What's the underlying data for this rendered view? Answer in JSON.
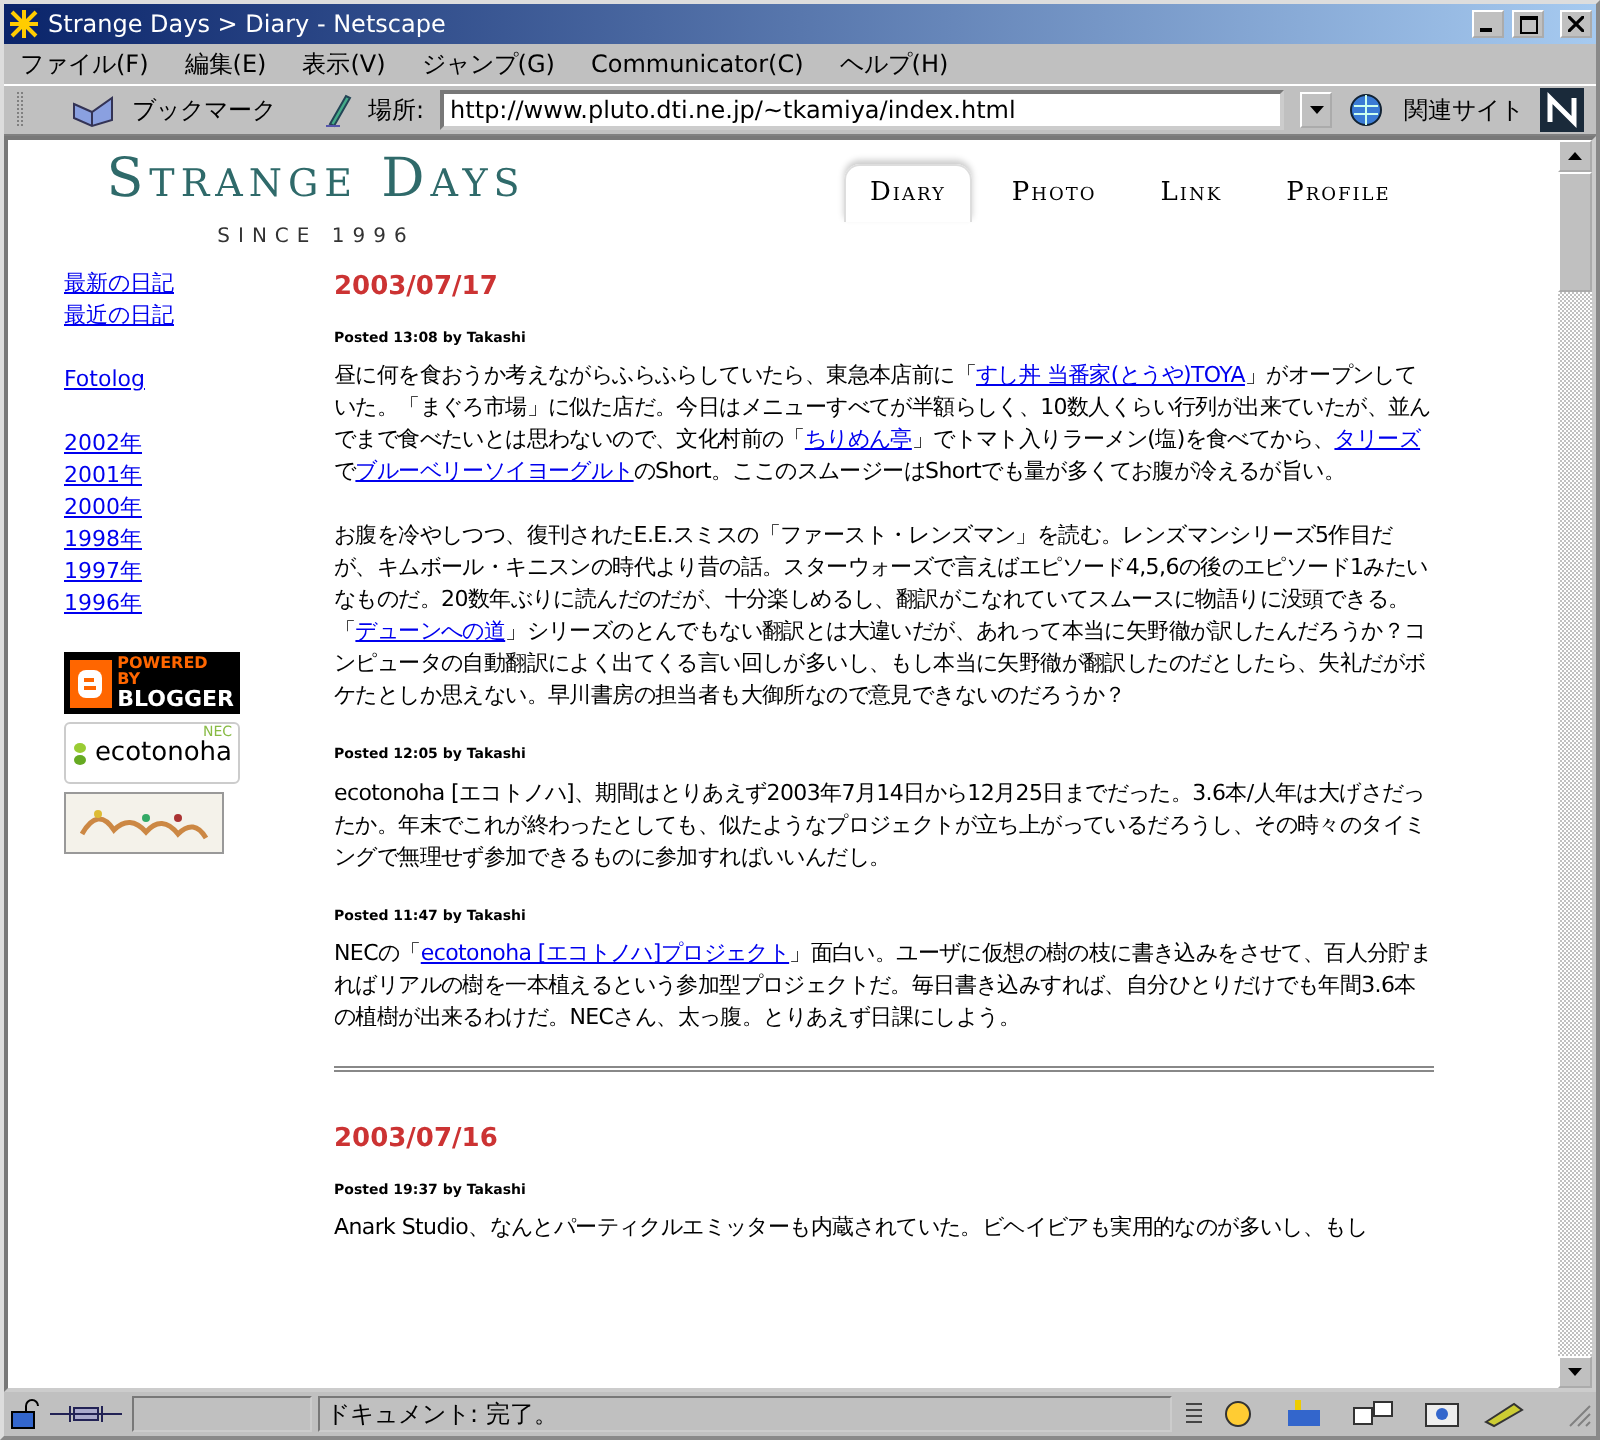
{
  "window": {
    "title": "Strange Days > Diary - Netscape"
  },
  "menu": [
    "ファイル(F)",
    "編集(E)",
    "表示(V)",
    "ジャンプ(G)",
    "Communicator(C)",
    "ヘルプ(H)"
  ],
  "toolbar": {
    "bookmarks": "ブックマーク",
    "location_label": "場所:",
    "url": "http://www.pluto.dti.ne.jp/~tkamiya/index.html",
    "related": "関連サイト"
  },
  "site": {
    "logo": "Strange Days",
    "since": "SINCE 1996",
    "tabs": [
      {
        "label": "Diary",
        "selected": true
      },
      {
        "label": "Photo",
        "selected": false
      },
      {
        "label": "Link",
        "selected": false
      },
      {
        "label": "Profile",
        "selected": false
      }
    ]
  },
  "sidebar": {
    "groups": [
      [
        "最新の日記",
        "最近の日記"
      ],
      [
        "Fotolog"
      ],
      [
        "2002年",
        "2001年",
        "2000年",
        "1998年",
        "1997年",
        "1996年"
      ]
    ],
    "badges": [
      {
        "kind": "blogger",
        "line_1": "POWERED BY",
        "line_2": "BLOGGER"
      },
      {
        "kind": "ecotonoha",
        "line_1": "NEC",
        "line_2": "ecotonoha"
      },
      {
        "kind": "picture"
      }
    ]
  },
  "days": [
    {
      "date": "2003/07/17",
      "posts": [
        {
          "meta": "Posted 13:08 by Takashi",
          "paragraphs": [
            [
              {
                "text": "昼に何を食おうか考えながらふらふらしていたら、東急本店前に「"
              },
              {
                "text": "すし丼 当番家(とうや)TOYA",
                "link": true
              },
              {
                "text": "」がオープンしていた。「まぐろ市場」に似た店だ。今日はメニューすべてが半額らしく、10数人くらい行列が出来ていたが、並んでまで食べたいとは思わないので、文化村前の「"
              },
              {
                "text": "ちりめん亭",
                "link": true
              },
              {
                "text": "」でトマト入りラーメン(塩)を食べてから、"
              },
              {
                "text": "タリーズ",
                "link": true
              },
              {
                "text": "で"
              },
              {
                "text": "ブルーベリーソイヨーグルト",
                "link": true
              },
              {
                "text": "のShort。ここのスムージーはShortでも量が多くてお腹が冷えるが旨い。"
              }
            ],
            [
              {
                "text": "お腹を冷やしつつ、復刊されたE.E.スミスの「ファースト・レンズマン」を読む。レンズマンシリーズ5作目だが、キムボール・キニスンの時代より昔の話。スターウォーズで言えばエピソード4,5,6の後のエピソード1みたいなものだ。20数年ぶりに読んだのだが、十分楽しめるし、翻訳がこなれていてスムースに物語りに没頭できる。「"
              },
              {
                "text": "デューンへの道",
                "link": true
              },
              {
                "text": "」シリーズのとんでもない翻訳とは大違いだが、あれって本当に矢野徹が訳したんだろうか？コンピュータの自動翻訳によく出てくる言い回しが多いし、もし本当に矢野徹が翻訳したのだとしたら、失礼だがボケたとしか思えない。早川書房の担当者も大御所なので意見できないのだろうか？"
              }
            ]
          ]
        },
        {
          "meta": "Posted 12:05 by Takashi",
          "paragraphs": [
            [
              {
                "text": "ecotonoha [エコトノハ]、期間はとりあえず2003年7月14日から12月25日までだった。3.6本/人年は大げさだったか。年末でこれが終わったとしても、似たようなプロジェクトが立ち上がっているだろうし、その時々のタイミングで無理せず参加できるものに参加すればいいんだし。"
              }
            ]
          ]
        },
        {
          "meta": "Posted 11:47 by Takashi",
          "paragraphs": [
            [
              {
                "text": "NECの「"
              },
              {
                "text": "ecotonoha [エコトノハ]プロジェクト",
                "link": true
              },
              {
                "text": "」面白い。ユーザに仮想の樹の枝に書き込みをさせて、百人分貯まればリアルの樹を一本植えるという参加型プロジェクトだ。毎日書き込みすれば、自分ひとりだけでも年間3.6本の植樹が出来るわけだ。NECさん、太っ腹。とりあえず日課にしよう。"
              }
            ]
          ]
        }
      ]
    },
    {
      "date": "2003/07/16",
      "posts": [
        {
          "meta": "Posted 19:37 by Takashi",
          "paragraphs": [
            [
              {
                "text": "Anark Studio、なんとパーティクルエミッターも内蔵されていた。ビヘイビアも実用的なのが多いし、もし"
              }
            ]
          ]
        }
      ]
    }
  ],
  "status_bar": {
    "text": "ドキュメント: 完了。"
  }
}
